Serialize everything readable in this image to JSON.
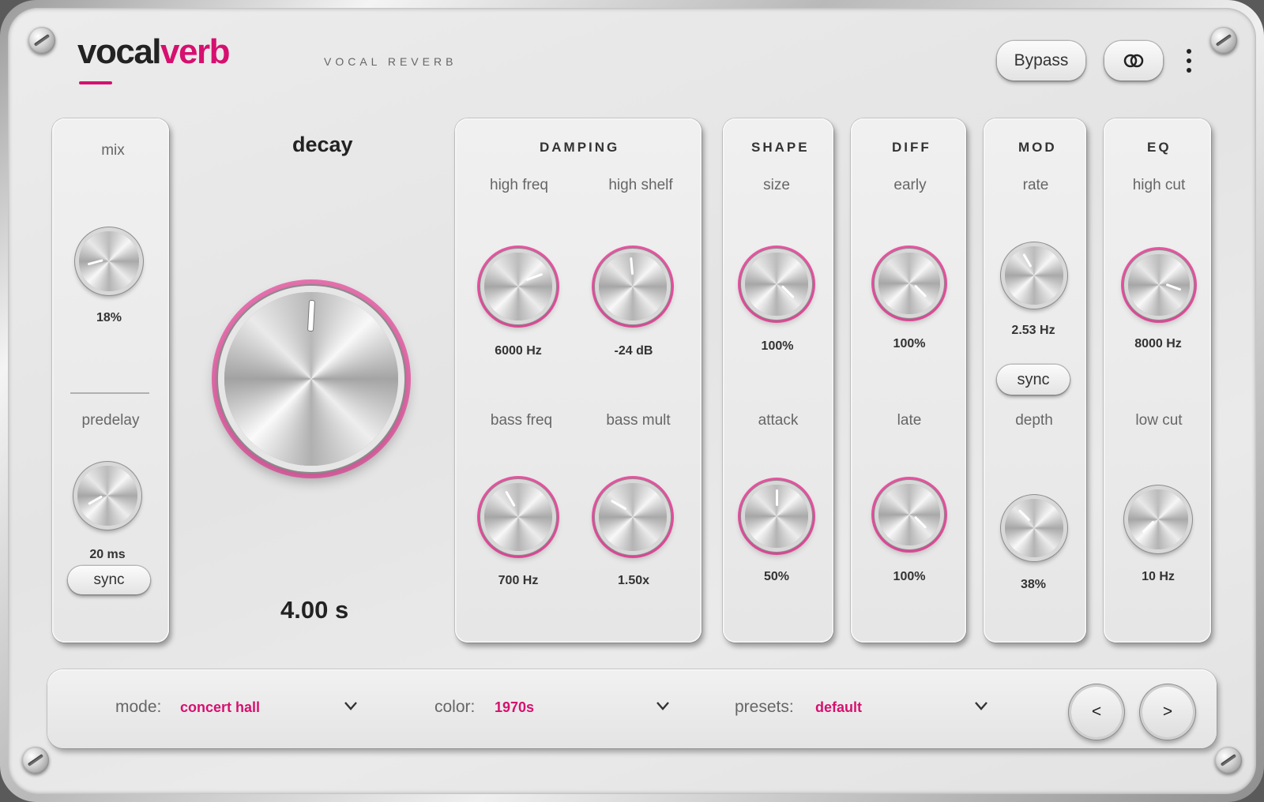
{
  "header": {
    "logo_part1": "vocal",
    "logo_part2": "verb",
    "subtitle": "VOCAL REVERB",
    "bypass_label": "Bypass",
    "link_icon": "link-rings-icon",
    "menu_icon": "kebab-menu-icon"
  },
  "colors": {
    "accent": "#d6106f",
    "panel": "#e8e8e8"
  },
  "mix_section": {
    "mix_label": "mix",
    "mix_value": "18%",
    "predelay_label": "predelay",
    "predelay_value": "20 ms",
    "sync_label": "sync"
  },
  "decay": {
    "label": "decay",
    "value": "4.00 s"
  },
  "damping": {
    "title": "DAMPING",
    "high_freq_label": "high freq",
    "high_freq_value": "6000 Hz",
    "high_shelf_label": "high shelf",
    "high_shelf_value": "-24 dB",
    "bass_freq_label": "bass freq",
    "bass_freq_value": "700 Hz",
    "bass_mult_label": "bass mult",
    "bass_mult_value": "1.50x"
  },
  "shape": {
    "title": "SHAPE",
    "size_label": "size",
    "size_value": "100%",
    "attack_label": "attack",
    "attack_value": "50%"
  },
  "diff": {
    "title": "DIFF",
    "early_label": "early",
    "early_value": "100%",
    "late_label": "late",
    "late_value": "100%"
  },
  "mod": {
    "title": "MOD",
    "rate_label": "rate",
    "rate_value": "2.53 Hz",
    "sync_label": "sync",
    "depth_label": "depth",
    "depth_value": "38%"
  },
  "eq": {
    "title": "EQ",
    "high_cut_label": "high cut",
    "high_cut_value": "8000 Hz",
    "low_cut_label": "low cut",
    "low_cut_value": "10 Hz"
  },
  "footer": {
    "mode_label": "mode:",
    "mode_value": "concert hall",
    "color_label": "color:",
    "color_value": "1970s",
    "presets_label": "presets:",
    "presets_value": "default",
    "prev_label": "<",
    "next_label": ">"
  }
}
